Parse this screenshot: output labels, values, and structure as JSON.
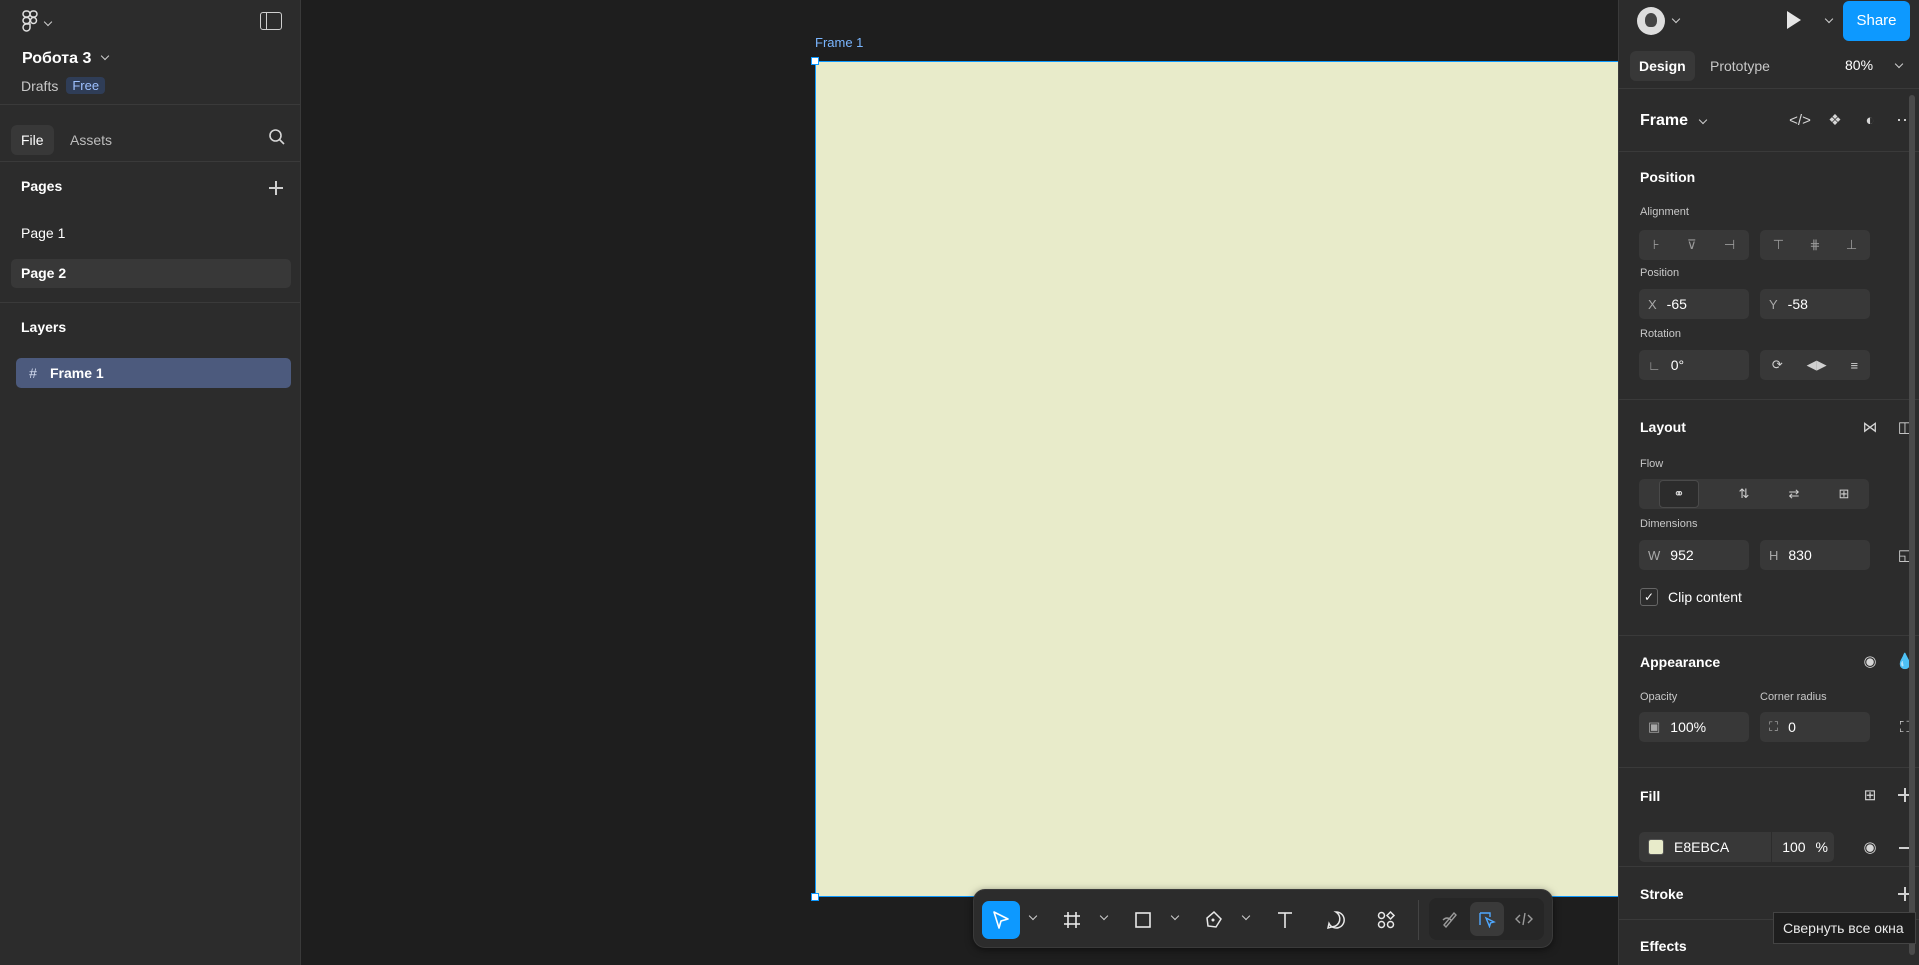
{
  "project": {
    "title": "Робота 3",
    "location": "Drafts",
    "plan": "Free"
  },
  "left_tabs": {
    "file": "File",
    "assets": "Assets"
  },
  "pages": {
    "header": "Pages",
    "items": [
      {
        "label": "Page 1"
      },
      {
        "label": "Page 2"
      }
    ]
  },
  "layers": {
    "header": "Layers",
    "items": [
      {
        "label": "Frame 1"
      }
    ]
  },
  "canvas": {
    "frame_label": "Frame 1",
    "frame_color": "#E8EBCA",
    "selection_color": "#0D99FF"
  },
  "toolbar": {
    "active_tool": "move",
    "tools": [
      "move",
      "frame",
      "rectangle",
      "pen",
      "text",
      "comment",
      "actions",
      "draw",
      "design",
      "dev-mode"
    ]
  },
  "header": {
    "share": "Share"
  },
  "right_tabs": {
    "design": "Design",
    "prototype": "Prototype",
    "zoom": "80%"
  },
  "inspector": {
    "type": "Frame",
    "position": {
      "title": "Position",
      "alignment_label": "Alignment",
      "position_label": "Position",
      "x_prefix": "X",
      "x": "-65",
      "y_prefix": "Y",
      "y": "-58",
      "rotation_label": "Rotation",
      "rotation": "0°"
    },
    "layout": {
      "title": "Layout",
      "flow_label": "Flow",
      "dimensions_label": "Dimensions",
      "w_prefix": "W",
      "w": "952",
      "h_prefix": "H",
      "h": "830",
      "clip_content": "Clip content",
      "clip_checked": true
    },
    "appearance": {
      "title": "Appearance",
      "opacity_label": "Opacity",
      "opacity": "100%",
      "corner_label": "Corner radius",
      "corner": "0"
    },
    "fill": {
      "title": "Fill",
      "hex": "E8EBCA",
      "opacity": "100",
      "unit": "%",
      "swatch": "#E8EBCA"
    },
    "stroke": {
      "title": "Stroke"
    },
    "effects": {
      "title": "Effects"
    }
  },
  "tooltip": "Свернуть все окна"
}
